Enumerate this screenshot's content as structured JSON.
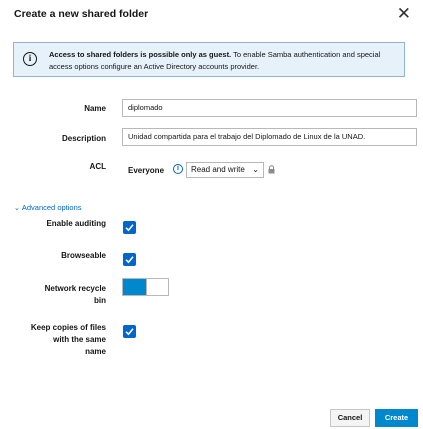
{
  "dialog": {
    "title": "Create a new shared folder",
    "close_symbol": "✕"
  },
  "alert": {
    "icon": "info-circle-icon",
    "bold_text": "Access to shared folders is possible only as guest.",
    "text": "To enable Samba authentication and special access options configure an Active Directory accounts provider."
  },
  "form": {
    "name_label": "Name",
    "name_value": "diplomado",
    "description_label": "Description",
    "description_value": "Unidad compartida para el trabajo del Diplomado de Linux de la UNAD.",
    "acl_label": "ACL",
    "acl_principal": "Everyone",
    "acl_permission": "Read and write"
  },
  "advanced": {
    "toggle_label": "Advanced options",
    "enable_auditing_label": "Enable auditing",
    "enable_auditing": true,
    "browseable_label": "Browseable",
    "browseable": true,
    "recycle_bin_label_1": "Network recycle",
    "recycle_bin_label_2": "bin",
    "recycle_bin": true,
    "keep_copies_label_1": "Keep copies of files",
    "keep_copies_label_2": "with the same",
    "keep_copies_label_3": "name",
    "keep_copies": true
  },
  "footer": {
    "cancel_label": "Cancel",
    "create_label": "Create"
  },
  "colors": {
    "accent": "#0066cc",
    "primary_button": "#0088ce",
    "alert_bg": "#e7f1fa"
  }
}
